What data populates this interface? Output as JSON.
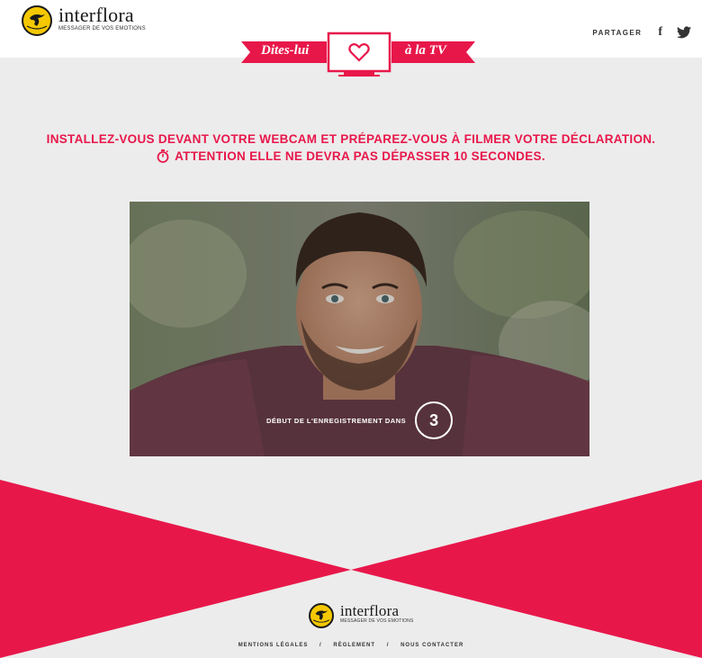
{
  "header": {
    "brand_name": "interflora",
    "brand_tagline": "MESSAGER DE VOS EMOTIONS",
    "logo_badge_text": "INTERFLORA",
    "share_label": "PARTAGER",
    "facebook_glyph": "f",
    "icons": [
      "logo-badge",
      "facebook-icon",
      "twitter-icon"
    ]
  },
  "banner": {
    "left_text": "Dites-lui",
    "right_text": "à la TV",
    "icon": "tv-heart-icon"
  },
  "headline": {
    "line1": "INSTALLEZ-VOUS DEVANT VOTRE WEBCAM ET PRÉPAREZ-VOUS À FILMER VOTRE DÉCLARATION.",
    "line2": "ATTENTION ELLE NE DEVRA PAS DÉPASSER 10 SECONDES.",
    "icon": "stopwatch-icon"
  },
  "webcam": {
    "countdown_label": "DÉBUT DE L'ENREGISTREMENT DANS",
    "countdown_value": "3"
  },
  "footer": {
    "brand_name": "interflora",
    "brand_tagline": "MESSAGER DE VOS EMOTIONS",
    "links": [
      "MENTIONS LÉGALES",
      "RÈGLEMENT",
      "NOUS CONTACTER"
    ],
    "separator": "/"
  },
  "colors": {
    "accent": "#e8174a",
    "logo_yellow": "#f5c800",
    "background": "#ececec"
  }
}
